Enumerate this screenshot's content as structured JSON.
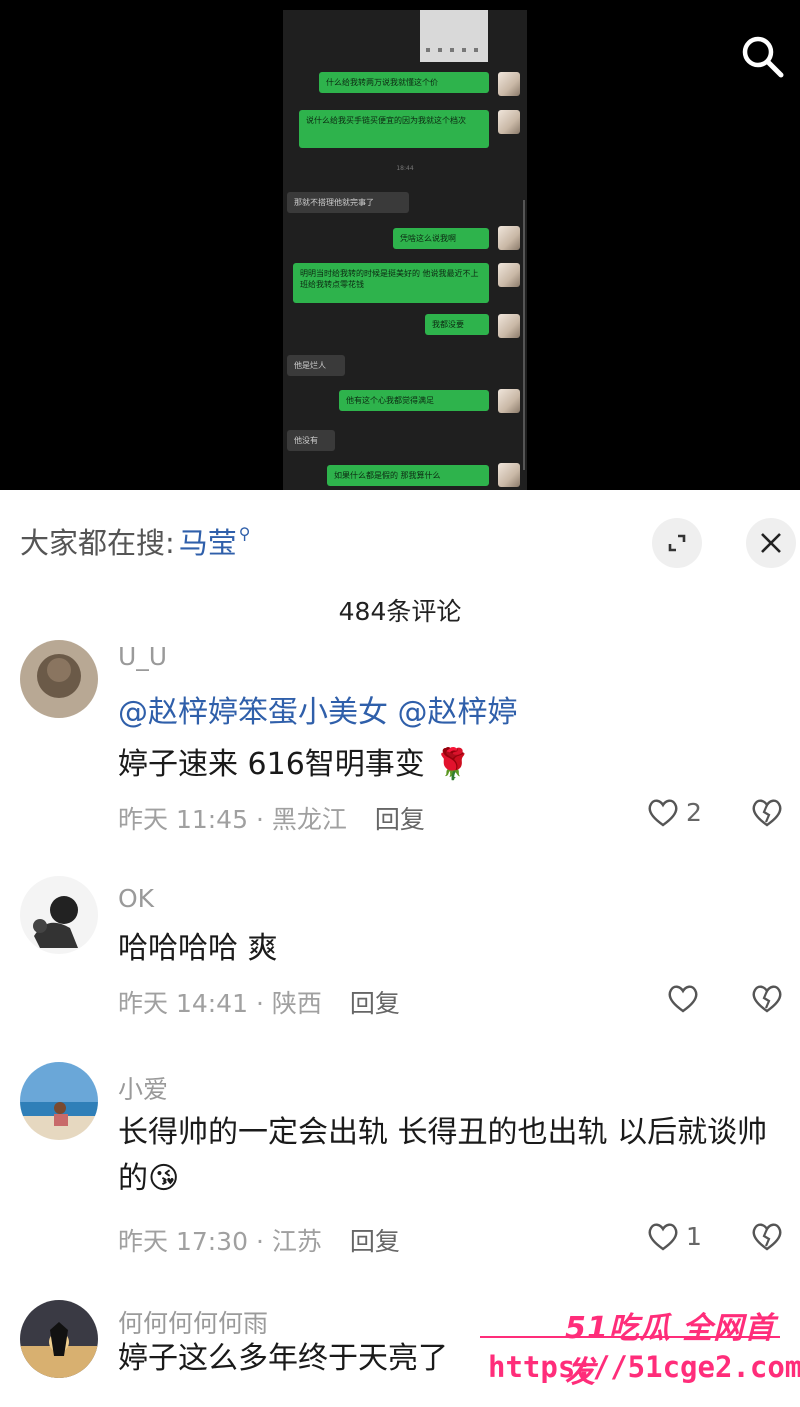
{
  "video": {
    "chat_messages": [
      {
        "side": "right",
        "text": "什么给我转两万说我就懂这个价"
      },
      {
        "side": "right",
        "text": "说什么给我买手链买便宜的因为我就这个档次"
      },
      {
        "side": "time",
        "text": "18:44"
      },
      {
        "side": "left",
        "text": "那就不搭理他就完事了"
      },
      {
        "side": "right",
        "text": "凭啥这么说我啊"
      },
      {
        "side": "right",
        "text": "明明当时给我转的时候是挺美好的 他说我最近不上班给我转点零花钱"
      },
      {
        "side": "right",
        "text": "我都没要"
      },
      {
        "side": "left",
        "text": "他是烂人"
      },
      {
        "side": "right",
        "text": "他有这个心我都觉得满足"
      },
      {
        "side": "left",
        "text": "他没有"
      },
      {
        "side": "right",
        "text": "如果什么都是假的 那我算什么"
      }
    ]
  },
  "header": {
    "search_prefix": "大家都在搜:",
    "search_keyword": "马莹",
    "comment_count": "484条评论"
  },
  "comments": [
    {
      "user": "U_U",
      "mentions": "@赵梓婷笨蛋小美女 @赵梓婷",
      "text": "婷子速来 616智明事变 🌹",
      "time": "昨天 11:45 · 黑龙江",
      "reply": "回复",
      "likes": "2"
    },
    {
      "user": "OK",
      "text": "哈哈哈哈 爽",
      "time": "昨天 14:41 · 陕西",
      "reply": "回复",
      "likes": ""
    },
    {
      "user": "小爱",
      "text": "长得帅的一定会出轨 长得丑的也出轨 以后就谈帅的😘",
      "time": "昨天 17:30 · 江苏",
      "reply": "回复",
      "likes": "1"
    },
    {
      "user": "何何何何何雨",
      "text": "婷子这么多年终于天亮了",
      "time": "",
      "reply": "",
      "likes": ""
    }
  ],
  "watermark": {
    "line1": "51吃瓜 全网首发",
    "line2": "https://51cge2.com"
  },
  "colors": {
    "mention": "#2f5faa",
    "chat_green": "#2eb34c",
    "watermark": "#ff2d7a"
  }
}
